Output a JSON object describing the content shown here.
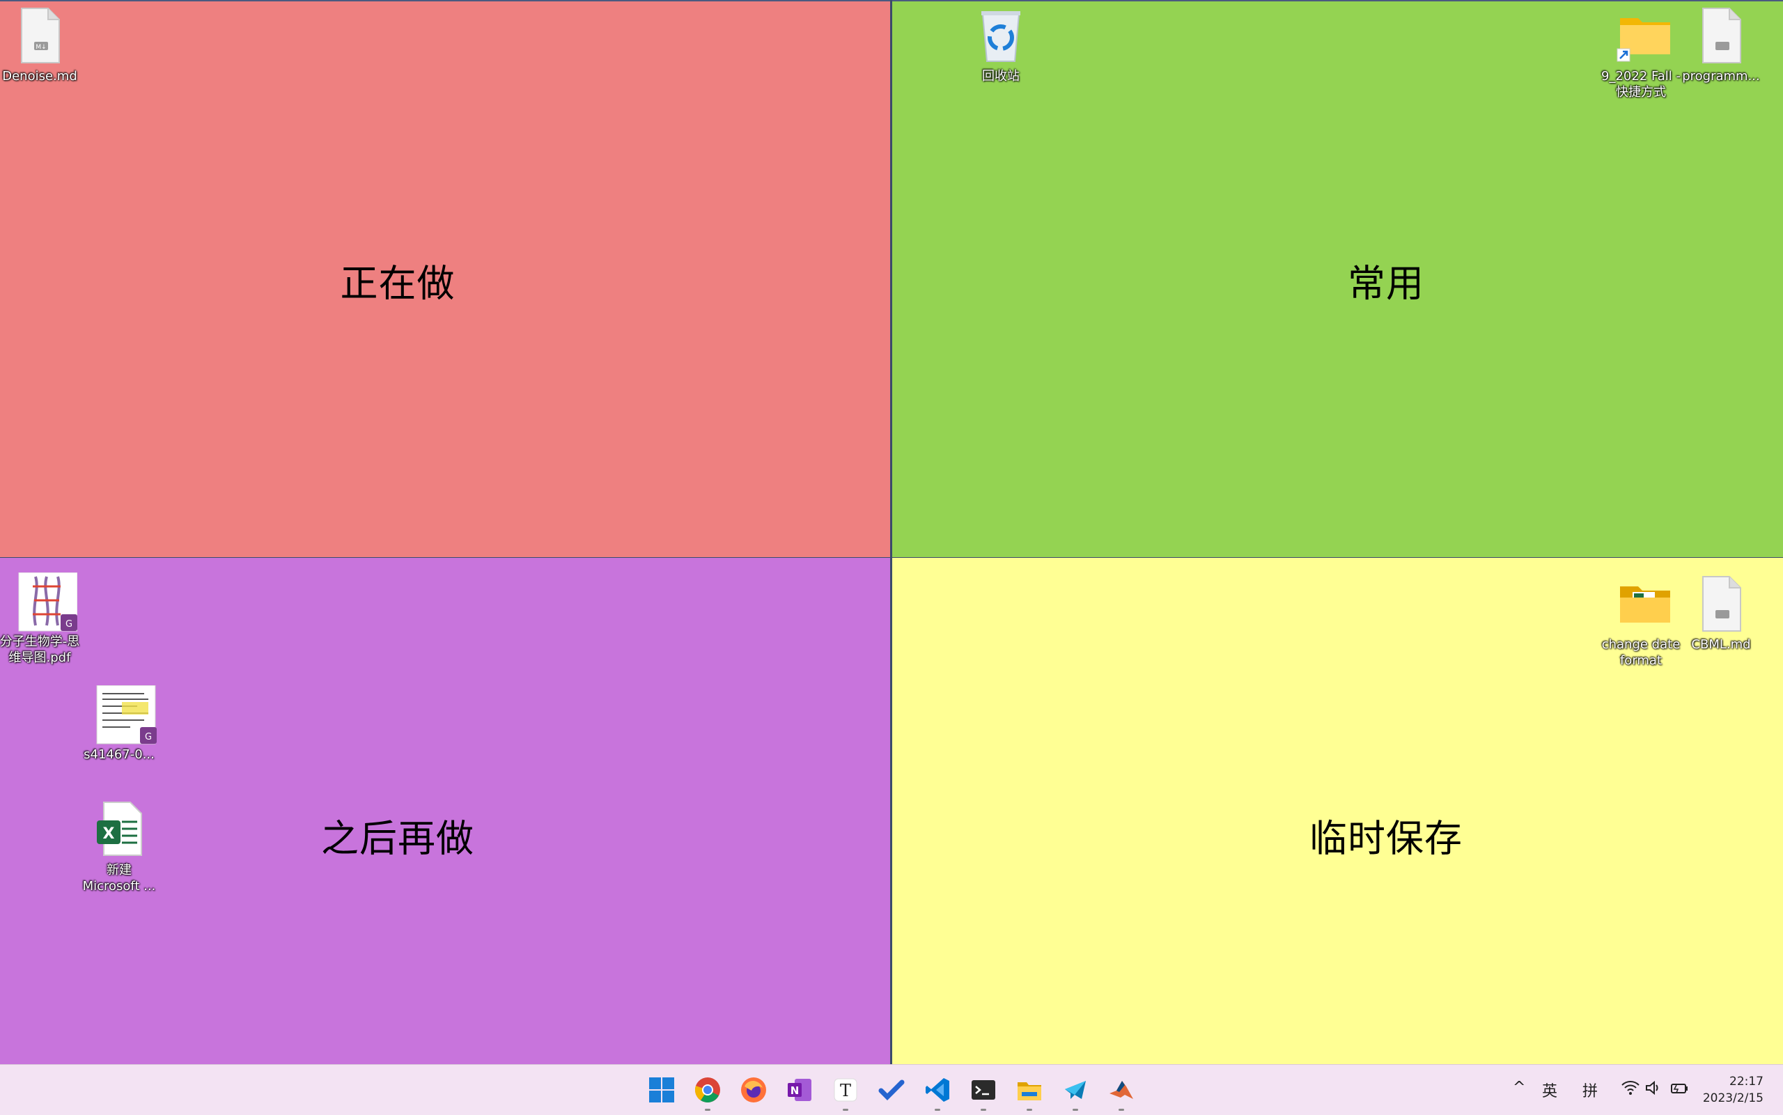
{
  "zones": {
    "top_left": "正在做",
    "top_right": "常用",
    "bottom_left": "之后再做",
    "bottom_right": "临时保存"
  },
  "colors": {
    "top_left": "#ee8080",
    "top_right": "#94d352",
    "bottom_left": "#c874dc",
    "bottom_right": "#ffff94",
    "taskbar": "#f3e3f3"
  },
  "desktop_icons": {
    "denoise": "Denoise.md",
    "recycle_bin": "回收站",
    "folder_shortcut": "9_2022 Fall - 快捷方式",
    "programm": "programm...",
    "molecular_pdf": "分子生物学-思维导图.pdf",
    "s41467": "s41467-0...",
    "new_excel": "新建 Microsoft ...",
    "change_date": "change date format",
    "cbml": "CBML.md"
  },
  "taskbar": {
    "apps": [
      "start-icon",
      "chrome-icon",
      "firefox-icon",
      "onenote-icon",
      "typora-icon",
      "todo-icon",
      "vscode-icon",
      "terminal-icon",
      "file-explorer-icon",
      "mailspring-icon",
      "matlab-icon"
    ],
    "tray": {
      "chevron": "^",
      "lang": "英",
      "ime": "拼"
    },
    "clock": {
      "time": "22:17",
      "date": "2023/2/15"
    }
  }
}
